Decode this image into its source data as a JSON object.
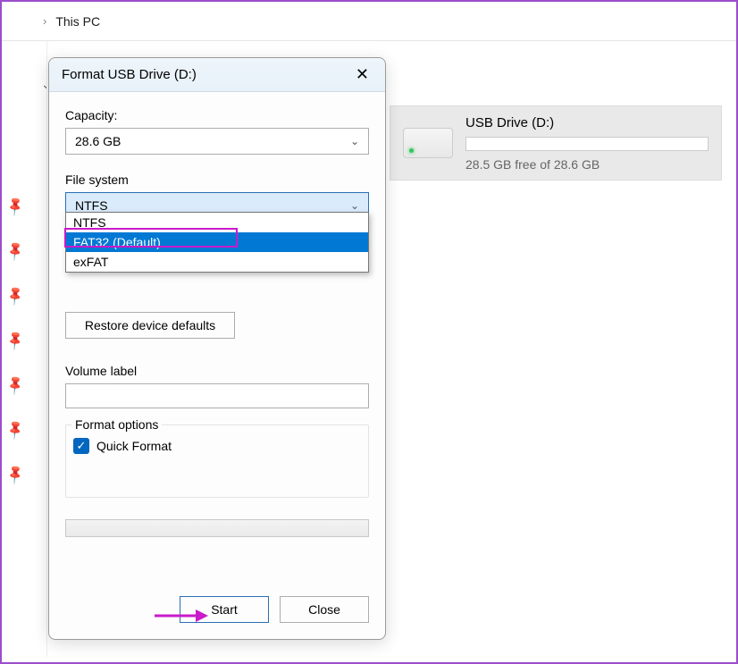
{
  "breadcrumb": {
    "location": "This PC"
  },
  "drive": {
    "name": "USB Drive (D:)",
    "free_text": "28.5 GB free of 28.6 GB"
  },
  "dialog": {
    "title": "Format USB Drive (D:)",
    "capacity_label": "Capacity:",
    "capacity_value": "28.6 GB",
    "filesystem_label": "File system",
    "filesystem_value": "NTFS",
    "filesystem_options": [
      "NTFS",
      "FAT32 (Default)",
      "exFAT"
    ],
    "restore_label": "Restore device defaults",
    "volume_label_text": "Volume label",
    "volume_label_value": "",
    "format_options_legend": "Format options",
    "quick_format_label": "Quick Format",
    "quick_format_checked": true,
    "start_label": "Start",
    "close_label": "Close"
  }
}
